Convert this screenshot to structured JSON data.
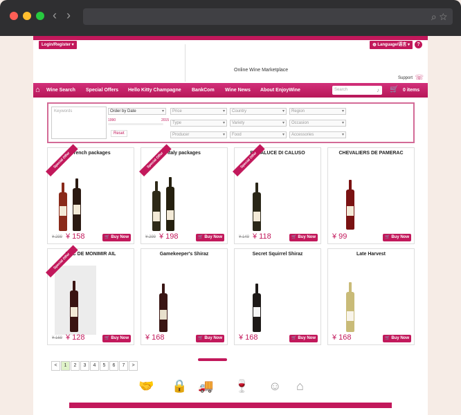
{
  "header": {
    "login": "Login/Register ▾",
    "language": "Language/语言 ▾",
    "help": "?",
    "tagline": "Online Wine Marketplace",
    "support": "Support"
  },
  "nav": {
    "items": [
      "Wine Search",
      "Special Offers",
      "Hello Kitty Champagne",
      "BankCom",
      "Wine News",
      "About EnjoyWine"
    ],
    "search_placeholder": "Search",
    "cart": "0 items"
  },
  "filters": {
    "keywords": "Keywords",
    "order": "Order by Date",
    "year_min": "1990",
    "year_max": "2015",
    "reset": "Reset",
    "dropdowns": [
      "Price",
      "Country",
      "Region",
      "Type",
      "Variety",
      "Occasion",
      "Producer",
      "Food",
      "Accessories"
    ]
  },
  "products": [
    {
      "name": "French packages",
      "old": "¥ 299",
      "price": "¥ 158",
      "special": "Special Offer",
      "buy": "Buy Now"
    },
    {
      "name": "Italy packages",
      "old": "¥ 299",
      "price": "¥ 198",
      "special": "Special Offer",
      "buy": "Buy Now"
    },
    {
      "name": "ERBALUCE DI CALUSO",
      "old": "¥ 149",
      "price": "¥ 118",
      "special": "Special Offer",
      "buy": "Buy Now"
    },
    {
      "name": "CHEVALIERS DE PAMERAC",
      "old": "",
      "price": "¥ 99",
      "special": "",
      "buy": "Buy Now"
    },
    {
      "name": "DUC DE MONIMIR AIL",
      "old": "¥ 169",
      "price": "¥ 128",
      "special": "Special Offer",
      "buy": "Buy Now"
    },
    {
      "name": "Gamekeeper's Shiraz",
      "old": "",
      "price": "¥ 168",
      "special": "",
      "buy": "Buy Now"
    },
    {
      "name": "Secret Squirrel Shiraz",
      "old": "",
      "price": "¥ 168",
      "special": "",
      "buy": "Buy Now"
    },
    {
      "name": "Late Harvest",
      "old": "",
      "price": "¥ 168",
      "special": "",
      "buy": "Buy Now"
    }
  ],
  "pagination": [
    "<",
    "1",
    "2",
    "3",
    "4",
    "5",
    "6",
    "7",
    ">"
  ],
  "colors": {
    "accent": "#c2185b"
  }
}
